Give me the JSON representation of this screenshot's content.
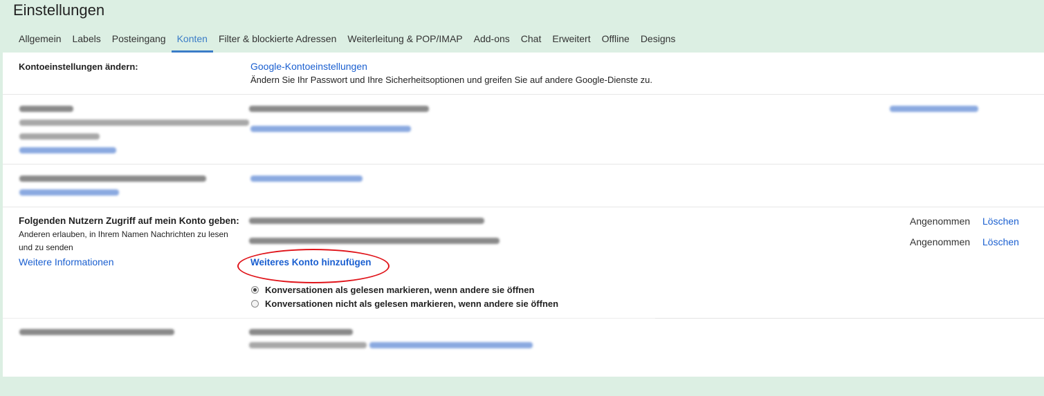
{
  "title": "Einstellungen",
  "tabs": [
    "Allgemein",
    "Labels",
    "Posteingang",
    "Konten",
    "Filter & blockierte Adressen",
    "Weiterleitung & POP/IMAP",
    "Add-ons",
    "Chat",
    "Erweitert",
    "Offline",
    "Designs"
  ],
  "active_tab": "Konten",
  "account_settings": {
    "label": "Kontoeinstellungen ändern:",
    "link": "Google-Kontoeinstellungen",
    "description": "Ändern Sie Ihr Passwort und Ihre Sicherheitsoptionen und greifen Sie auf andere Google-Dienste zu."
  },
  "delegation": {
    "label": "Folgenden Nutzern Zugriff auf mein Konto geben:",
    "description_line1": "Anderen erlauben, in Ihrem Namen Nachrichten zu lesen",
    "description_line2": "und zu senden",
    "more_info": "Weitere Informationen",
    "add_account": "Weiteres Konto hinzufügen",
    "entries": [
      {
        "status": "Angenommen",
        "action": "Löschen"
      },
      {
        "status": "Angenommen",
        "action": "Löschen"
      }
    ],
    "options": [
      {
        "label": "Konversationen als gelesen markieren, wenn andere sie öffnen",
        "selected": true
      },
      {
        "label": "Konversationen nicht als gelesen markieren, wenn andere sie öffnen",
        "selected": false
      }
    ]
  },
  "colors": {
    "accent": "#3a7cc7",
    "link": "#1a5fd0",
    "highlight_ring": "#e0141a",
    "background": "#dcefe3"
  }
}
